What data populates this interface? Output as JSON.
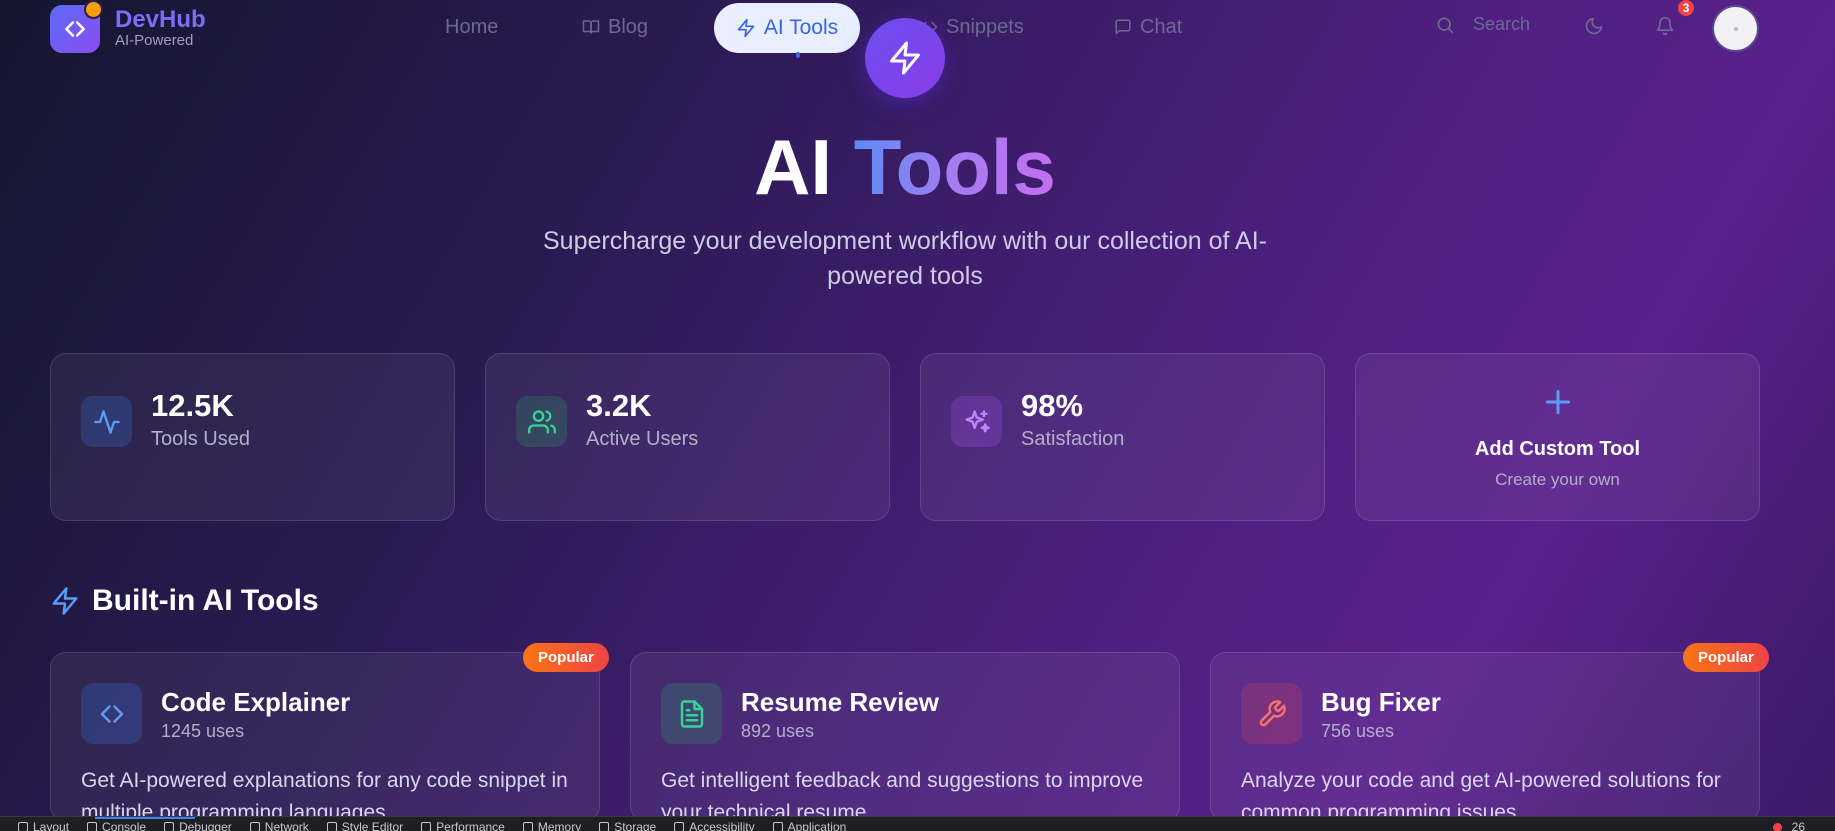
{
  "brand": {
    "name": "DevHub",
    "sub": "AI-Powered"
  },
  "nav": {
    "items": [
      {
        "label": "Home",
        "icon": "home"
      },
      {
        "label": "Blog",
        "icon": "book-icon"
      },
      {
        "label": "AI Tools",
        "icon": "bolt-icon",
        "active": true
      },
      {
        "label": "Snippets",
        "icon": "code-icon"
      },
      {
        "label": "Chat",
        "icon": "chat-icon"
      }
    ],
    "search_label": "Search",
    "notification_count": "3"
  },
  "hero": {
    "title_plain": "AI",
    "title_accent": "Tools",
    "subtitle": "Supercharge your development workflow with our collection of AI-powered tools"
  },
  "stats": [
    {
      "value": "12.5K",
      "label": "Tools Used",
      "icon": "activity-icon",
      "color": "#3b82f6"
    },
    {
      "value": "3.2K",
      "label": "Active Users",
      "icon": "users-icon",
      "color": "#22c55e"
    },
    {
      "value": "98%",
      "label": "Satisfaction",
      "icon": "sparkles-icon",
      "color": "#a855f7"
    }
  ],
  "add_tool": {
    "title": "Add Custom Tool",
    "subtitle": "Create your own"
  },
  "section": {
    "title": "Built-in AI Tools"
  },
  "tools": [
    {
      "name": "Code Explainer",
      "uses": "1245 uses",
      "description": "Get AI-powered explanations for any code snippet in multiple programming languages",
      "badge": "Popular",
      "icon": "code-icon",
      "color": "#3b82f6"
    },
    {
      "name": "Resume Review",
      "uses": "892 uses",
      "description": "Get intelligent feedback and suggestions to improve your technical resume",
      "badge": "",
      "icon": "document-icon",
      "color": "#22c55e"
    },
    {
      "name": "Bug Fixer",
      "uses": "756 uses",
      "description": "Analyze your code and get AI-powered solutions for common programming issues",
      "badge": "Popular",
      "icon": "wrench-icon",
      "color": "#ef4444"
    }
  ],
  "taskbar": {
    "items": [
      "Layout",
      "Console",
      "Debugger",
      "Network",
      "Style Editor",
      "Performance",
      "Memory",
      "Storage",
      "Accessibility",
      "Application"
    ],
    "error_count": "26"
  }
}
